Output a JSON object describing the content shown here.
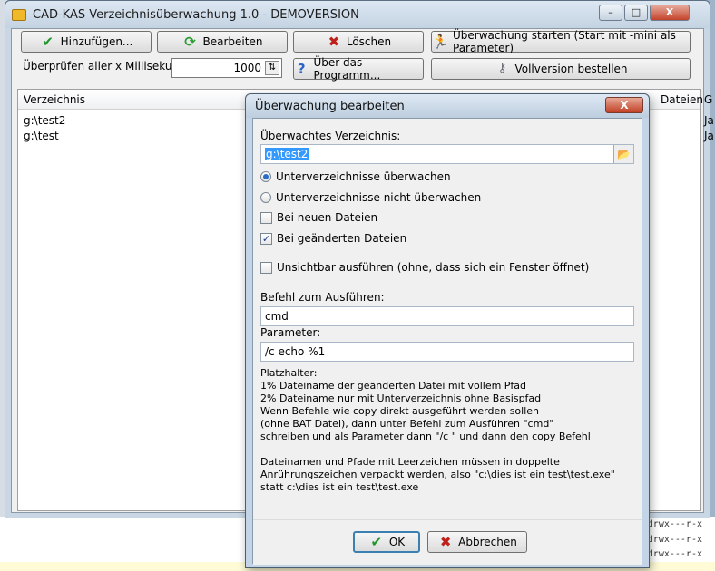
{
  "main": {
    "title": "CAD-KAS Verzeichnisüberwachung 1.0 - DEMOVERSION",
    "buttons": {
      "add": "Hinzufügen...",
      "edit": "Bearbeiten",
      "delete": "Löschen",
      "start": "Überwachung starten (Start mit -mini als Parameter)",
      "about": "Über das Programm...",
      "order": "Vollversion bestellen"
    },
    "interval_label": "Überprüfen aller x Millisekunden:",
    "interval_value": "1000",
    "list": {
      "columns": [
        "Verzeichnis",
        "Dateien",
        "G"
      ],
      "rows": [
        {
          "dir": "g:\\test2",
          "g": "Ja"
        },
        {
          "dir": "g:\\test",
          "g": "Ja"
        }
      ]
    }
  },
  "background_text": [
    "drwx---r-x",
    "drwx---r-x",
    "drwx---r-x"
  ],
  "dialog": {
    "title": "Überwachung bearbeiten",
    "watched_dir_label": "Überwachtes Verzeichnis:",
    "watched_dir_value": "g:\\test2",
    "radio_sub_watch": "Unterverzeichnisse überwachen",
    "radio_sub_nowatch": "Unterverzeichnisse nicht überwachen",
    "check_new": "Bei neuen Dateien",
    "check_changed": "Bei geänderten Dateien",
    "check_invisible": "Unsichtbar ausführen (ohne, dass sich ein Fenster öffnet)",
    "command_label": "Befehl zum Ausführen:",
    "command_value": "cmd",
    "param_label": "Parameter:",
    "param_value": "/c echo %1",
    "help_lines": [
      "Platzhalter:",
      "1% Dateiname der geänderten Datei mit vollem Pfad",
      "2% Dateiname nur mit Unterverzeichnis ohne Basispfad",
      "Wenn Befehle wie copy direkt ausgeführt werden sollen",
      "(ohne BAT Datei), dann unter Befehl zum Ausführen \"cmd\"",
      "schreiben und als Parameter dann \"/c \" und dann den copy Befehl",
      "",
      "Dateinamen und Pfade mit Leerzeichen müssen in doppelte",
      "Anrührungszeichen verpackt werden, also \"c:\\dies ist ein test\\test.exe\"",
      "statt c:\\dies ist ein test\\test.exe"
    ],
    "ok": "OK",
    "cancel": "Abbrechen",
    "close_glyph": "X"
  }
}
